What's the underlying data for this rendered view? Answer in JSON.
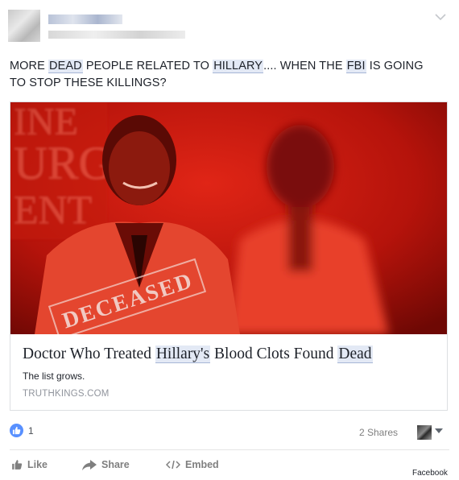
{
  "post": {
    "text_parts": {
      "p1": "MORE ",
      "dead": "DEAD",
      "p2": " PEOPLE RELATED TO ",
      "hillary": "HILLARY",
      "p3": ".... WHEN THE ",
      "fbi": "FBI",
      "p4": " IS GOING TO STOP THESE KILLINGS?"
    }
  },
  "card": {
    "image_stamp": "DECEASED",
    "background_sign": "URG",
    "title_parts": {
      "t1": "Doctor Who Treated ",
      "hillarys": "Hillary's",
      "t2": " Blood Clots Found ",
      "dead": "Dead"
    },
    "description": "The list grows.",
    "domain": "TRUTHKINGS.COM"
  },
  "footer": {
    "like_count": "1",
    "shares": "2 Shares"
  },
  "actions": {
    "like": "Like",
    "share": "Share",
    "embed": "Embed"
  },
  "watermark": "Facebook",
  "colors": {
    "facebook_blue": "#5890ff",
    "highlight": "#e3e9f5",
    "image_tint": "#b0100a"
  }
}
